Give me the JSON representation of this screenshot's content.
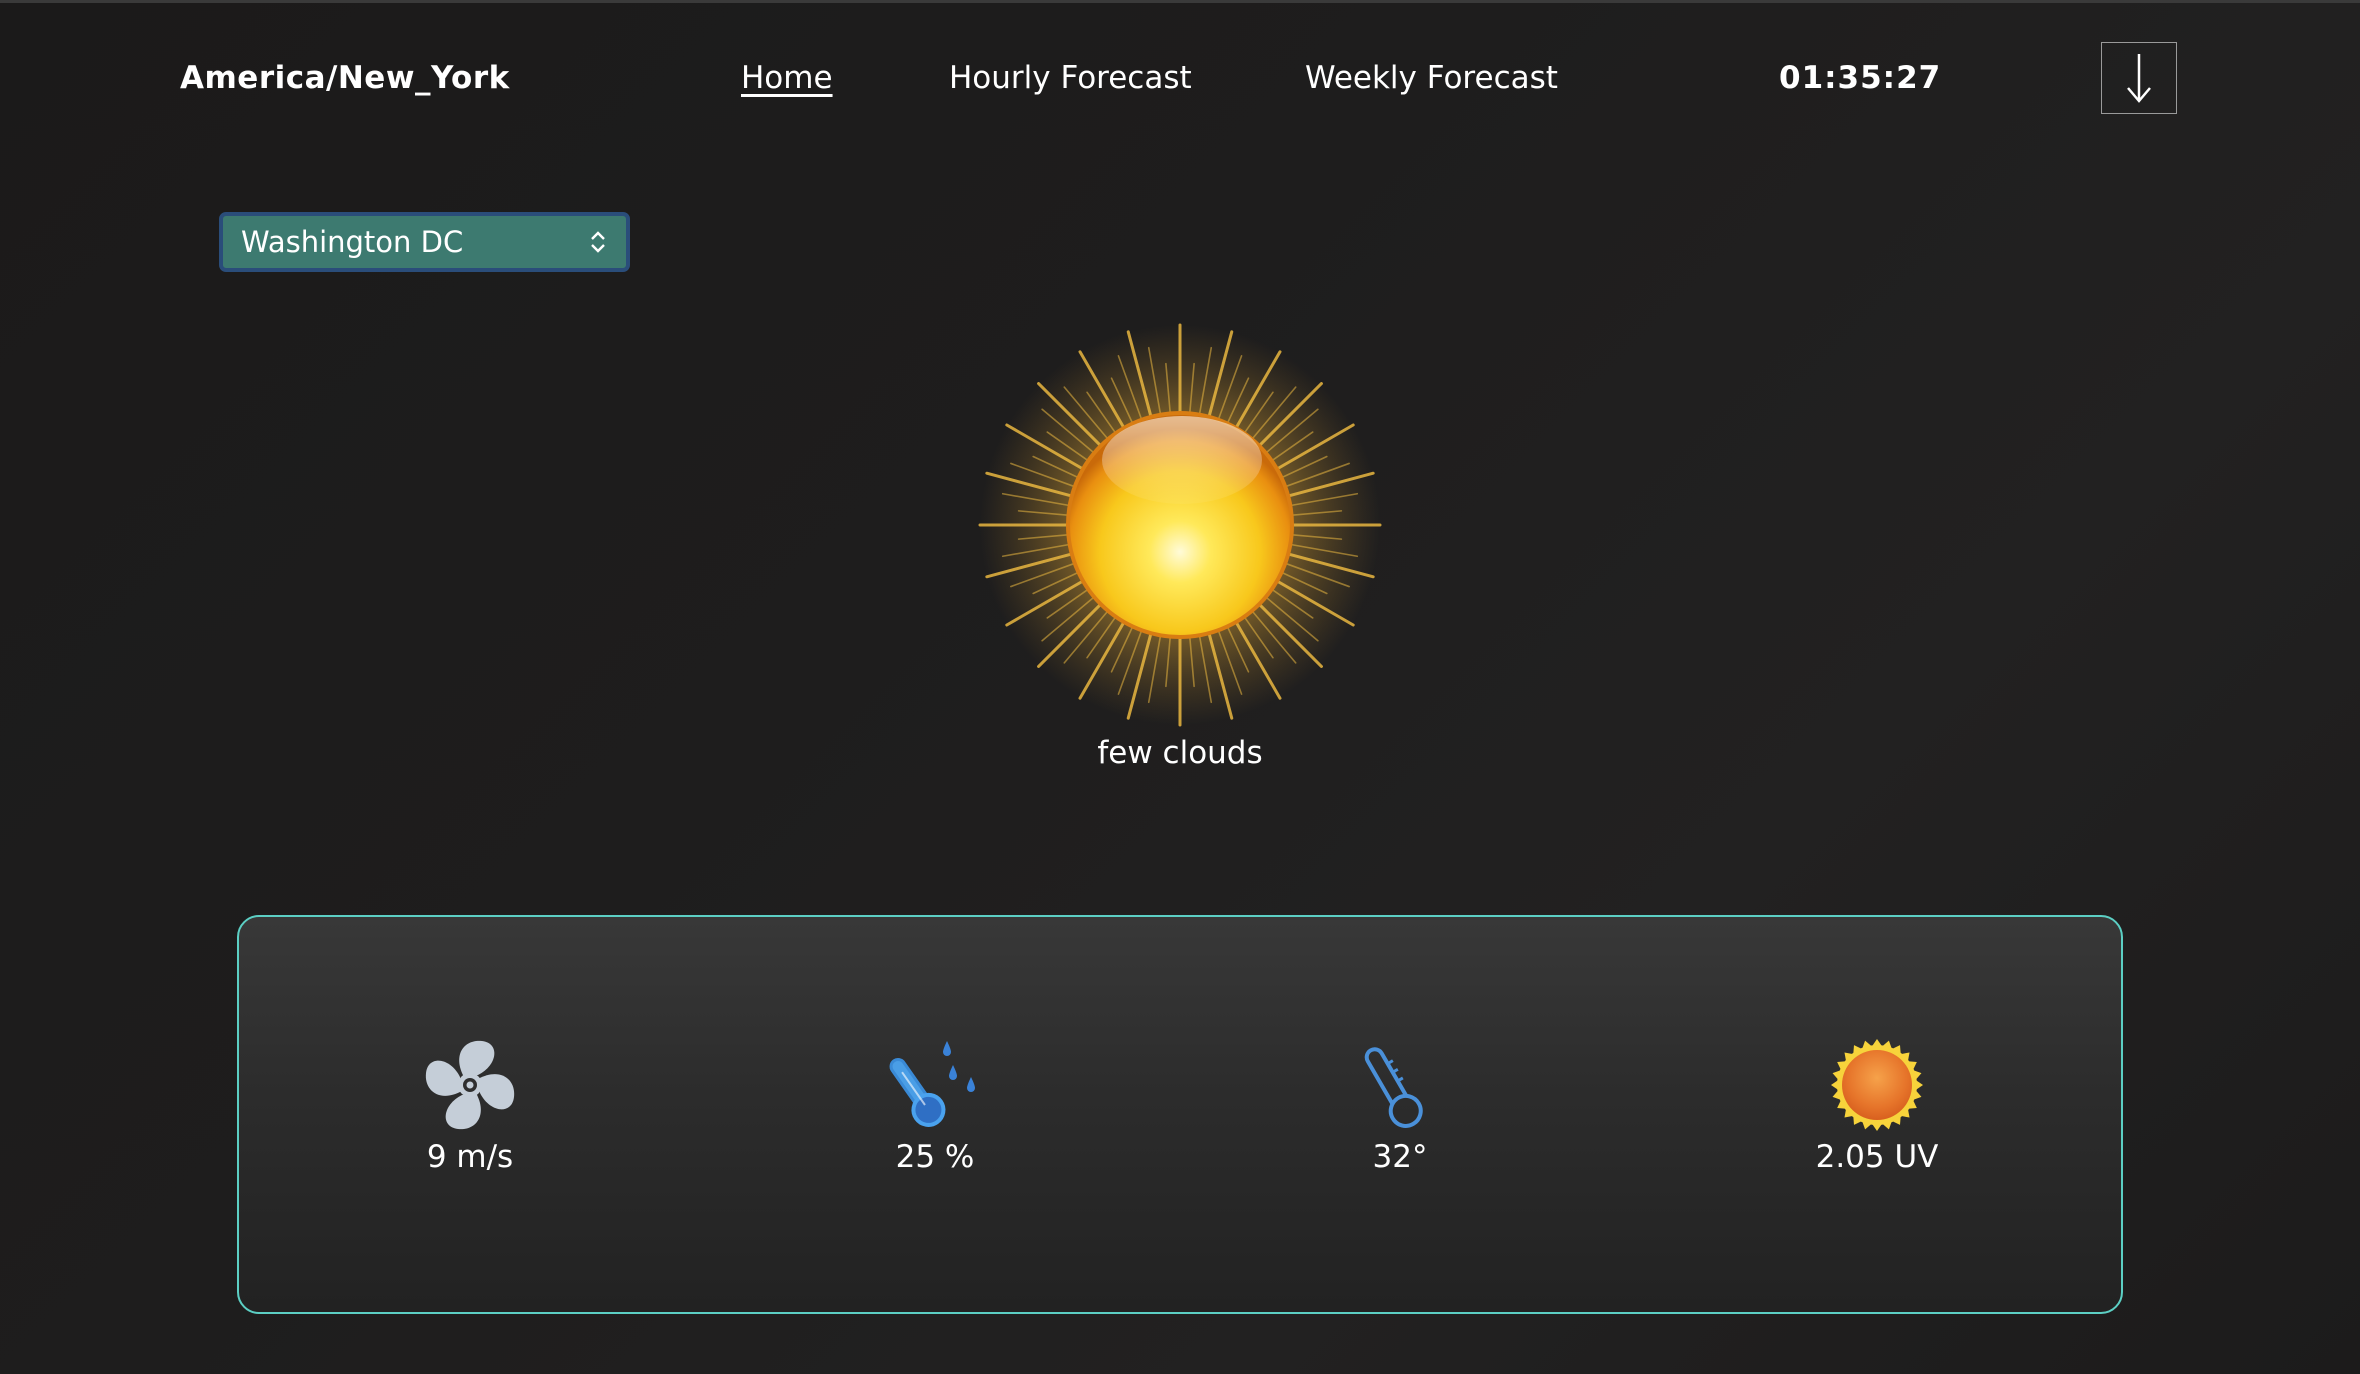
{
  "header": {
    "timezone": "America/New_York",
    "nav": [
      {
        "label": "Home",
        "active": true
      },
      {
        "label": "Hourly Forecast",
        "active": false
      },
      {
        "label": "Weekly Forecast",
        "active": false
      }
    ],
    "clock": "01:35:27",
    "download_icon": "arrow-down-icon"
  },
  "location": {
    "selected_city": "Washington DC",
    "icon": "chevron-up-down-icon"
  },
  "current": {
    "icon": "sun-icon",
    "condition": "few clouds"
  },
  "stats": [
    {
      "icon": "fan-icon",
      "value": "9 m/s"
    },
    {
      "icon": "humidity-thermometer-icon",
      "value": "25 %"
    },
    {
      "icon": "thermometer-icon",
      "value": "32°"
    },
    {
      "icon": "uv-sun-icon",
      "value": "2.05 UV"
    }
  ],
  "colors": {
    "accent_border": "#5ccfc4",
    "select_bg": "#3d7a70",
    "select_border": "#2a4d7a",
    "icon_blue": "#4a90d9"
  }
}
